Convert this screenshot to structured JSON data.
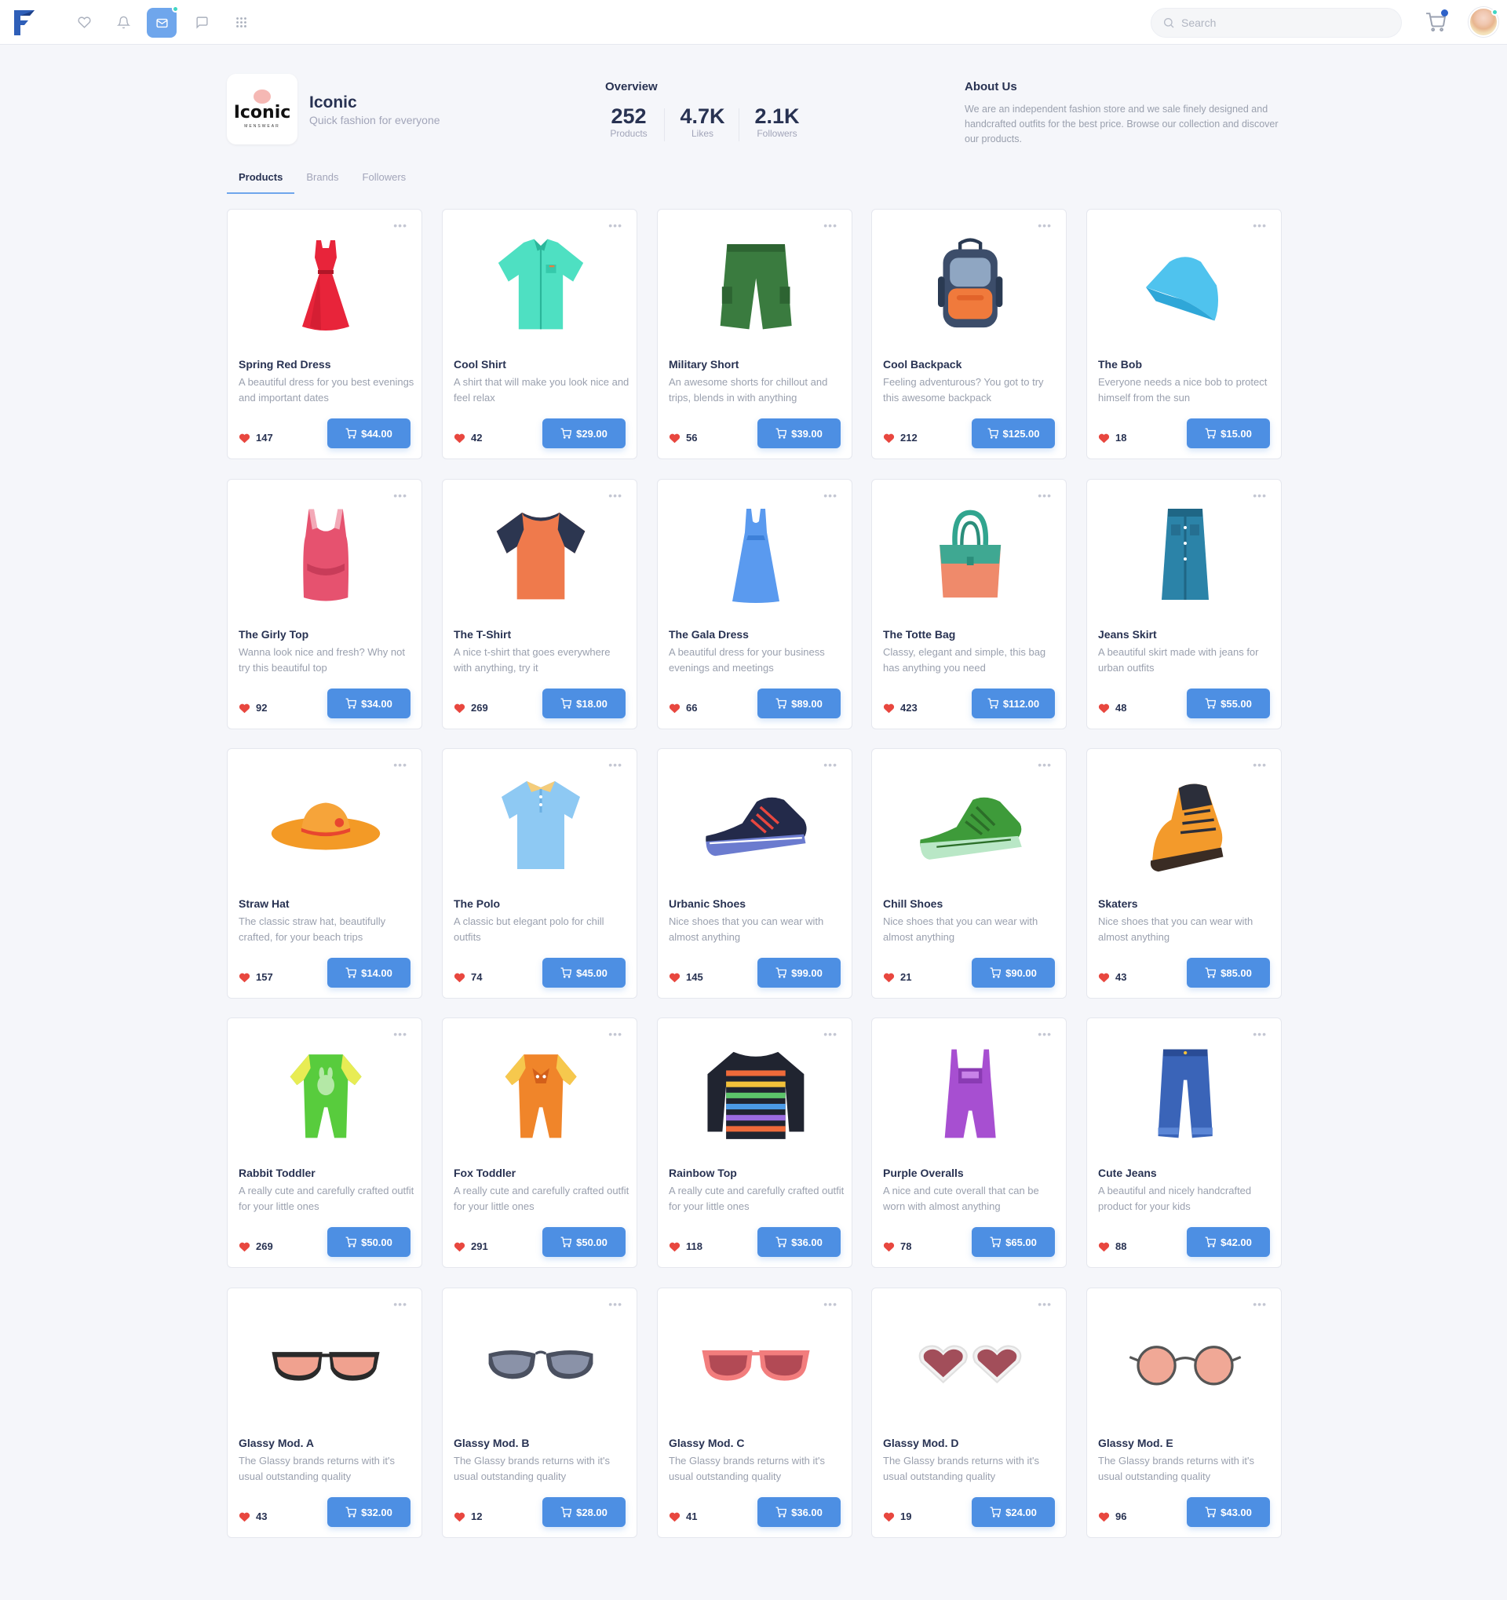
{
  "navbar": {
    "search_placeholder": "Search",
    "icons": [
      "heart-icon",
      "bell-icon",
      "mail-icon",
      "chat-icon",
      "grid-icon"
    ],
    "active_icon": "mail-icon"
  },
  "brand": {
    "logo_text": "Iconic",
    "logo_subtext": "MENSWEAR",
    "name": "Iconic",
    "tagline": "Quick fashion for everyone"
  },
  "overview": {
    "title": "Overview",
    "stats": [
      {
        "value": "252",
        "label": "Products"
      },
      {
        "value": "4.7K",
        "label": "Likes"
      },
      {
        "value": "2.1K",
        "label": "Followers"
      }
    ]
  },
  "about": {
    "title": "About Us",
    "text": "We are an independent fashion store and we sale finely designed and handcrafted outfits for the best price. Browse our collection and discover our products."
  },
  "tabs": [
    {
      "label": "Products",
      "active": true
    },
    {
      "label": "Brands",
      "active": false
    },
    {
      "label": "Followers",
      "active": false
    }
  ],
  "colors": {
    "accent": "#4d8fe3",
    "heart": "#e8473f",
    "text": "#283252",
    "muted": "#a2a5b9"
  },
  "products": [
    {
      "title": "Spring Red Dress",
      "desc": "A beautiful dress for you best evenings and important dates",
      "likes": "147",
      "price": "$44.00",
      "icon": "dress"
    },
    {
      "title": "Cool Shirt",
      "desc": "A shirt that will make you look nice and feel relax",
      "likes": "42",
      "price": "$29.00",
      "icon": "shirt"
    },
    {
      "title": "Military Short",
      "desc": "An awesome shorts for chillout and trips, blends in with anything",
      "likes": "56",
      "price": "$39.00",
      "icon": "shorts"
    },
    {
      "title": "Cool Backpack",
      "desc": "Feeling adventurous? You got to try this awesome backpack",
      "likes": "212",
      "price": "$125.00",
      "icon": "backpack"
    },
    {
      "title": "The Bob",
      "desc": "Everyone needs a nice bob to protect himself from the sun",
      "likes": "18",
      "price": "$15.00",
      "icon": "bob"
    },
    {
      "title": "The Girly Top",
      "desc": "Wanna look nice and fresh? Why not try this beautiful top",
      "likes": "92",
      "price": "$34.00",
      "icon": "tanktop"
    },
    {
      "title": "The T-Shirt",
      "desc": "A nice t-shirt that goes everywhere with anything, try it",
      "likes": "269",
      "price": "$18.00",
      "icon": "tshirt"
    },
    {
      "title": "The Gala Dress",
      "desc": "A beautiful dress for your business evenings and meetings",
      "likes": "66",
      "price": "$89.00",
      "icon": "galadress"
    },
    {
      "title": "The Totte Bag",
      "desc": "Classy, elegant and simple, this bag has anything you need",
      "likes": "423",
      "price": "$112.00",
      "icon": "tote"
    },
    {
      "title": "Jeans Skirt",
      "desc": "A beautiful skirt made with jeans for urban outfits",
      "likes": "48",
      "price": "$55.00",
      "icon": "skirt"
    },
    {
      "title": "Straw Hat",
      "desc": "The classic straw hat, beautifully crafted, for your beach trips",
      "likes": "157",
      "price": "$14.00",
      "icon": "strawhat"
    },
    {
      "title": "The Polo",
      "desc": "A classic but elegant polo for chill outfits",
      "likes": "74",
      "price": "$45.00",
      "icon": "polo"
    },
    {
      "title": "Urbanic Shoes",
      "desc": "Nice shoes that you can wear with almost anything",
      "likes": "145",
      "price": "$99.00",
      "icon": "shoe-navy"
    },
    {
      "title": "Chill Shoes",
      "desc": "Nice shoes that you can wear with almost anything",
      "likes": "21",
      "price": "$90.00",
      "icon": "shoe-green"
    },
    {
      "title": "Skaters",
      "desc": "Nice shoes that you can wear with almost anything",
      "likes": "43",
      "price": "$85.00",
      "icon": "shoe-orange"
    },
    {
      "title": "Rabbit Toddler",
      "desc": "A really cute and carefully crafted outfit for your little ones",
      "likes": "269",
      "price": "$50.00",
      "icon": "romper-green"
    },
    {
      "title": "Fox Toddler",
      "desc": "A really cute and carefully crafted outfit for your little ones",
      "likes": "291",
      "price": "$50.00",
      "icon": "romper-orange"
    },
    {
      "title": "Rainbow Top",
      "desc": "A really cute and carefully crafted outfit for your little ones",
      "likes": "118",
      "price": "$36.00",
      "icon": "rainbow"
    },
    {
      "title": "Purple Overalls",
      "desc": "A nice and cute overall that can be worn with almost anything",
      "likes": "78",
      "price": "$65.00",
      "icon": "overalls"
    },
    {
      "title": "Cute Jeans",
      "desc": "A beautiful and nicely handcrafted product for your kids",
      "likes": "88",
      "price": "$42.00",
      "icon": "jeans"
    },
    {
      "title": "Glassy Mod. A",
      "desc": "The Glassy brands returns with it's usual outstanding quality",
      "likes": "43",
      "price": "$32.00",
      "icon": "glasses-a"
    },
    {
      "title": "Glassy Mod. B",
      "desc": "The Glassy brands returns with it's usual outstanding quality",
      "likes": "12",
      "price": "$28.00",
      "icon": "glasses-b"
    },
    {
      "title": "Glassy Mod. C",
      "desc": "The Glassy brands returns with it's usual outstanding quality",
      "likes": "41",
      "price": "$36.00",
      "icon": "glasses-c"
    },
    {
      "title": "Glassy Mod. D",
      "desc": "The Glassy brands returns with it's usual outstanding quality",
      "likes": "19",
      "price": "$24.00",
      "icon": "glasses-d"
    },
    {
      "title": "Glassy Mod. E",
      "desc": "The Glassy brands returns with it's usual outstanding quality",
      "likes": "96",
      "price": "$43.00",
      "icon": "glasses-e"
    }
  ]
}
